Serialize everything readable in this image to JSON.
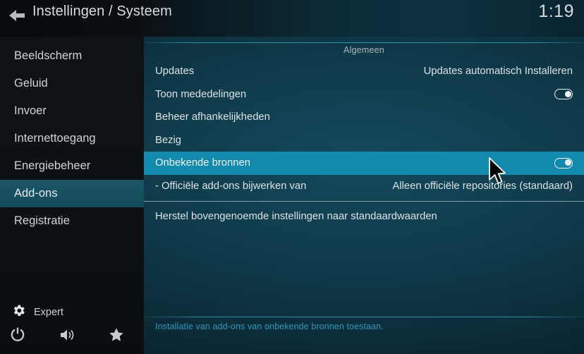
{
  "header": {
    "back_icon": "back-arrow-icon",
    "title": "Instellingen / Systeem",
    "clock": "1:19"
  },
  "sidebar": {
    "items": [
      {
        "label": "Beeldscherm",
        "selected": false
      },
      {
        "label": "Geluid",
        "selected": false
      },
      {
        "label": "Invoer",
        "selected": false
      },
      {
        "label": "Internettoegang",
        "selected": false
      },
      {
        "label": "Energiebeheer",
        "selected": false
      },
      {
        "label": "Add-ons",
        "selected": true
      },
      {
        "label": "Registratie",
        "selected": false
      }
    ],
    "footer": {
      "level_icon": "gear-icon",
      "level_label": "Expert",
      "buttons": [
        {
          "icon": "power-icon"
        },
        {
          "icon": "volume-icon"
        },
        {
          "icon": "star-icon"
        }
      ]
    }
  },
  "content": {
    "section_title": "Algemeen",
    "rows": [
      {
        "label": "Updates",
        "value": "Updates automatisch Installeren",
        "control": "value",
        "highlighted": false
      },
      {
        "label": "Toon mededelingen",
        "value": "",
        "control": "toggle",
        "toggle_on": true,
        "highlighted": false
      },
      {
        "label": "Beheer afhankelijkheden",
        "value": "",
        "control": "none",
        "highlighted": false
      },
      {
        "label": "Bezig",
        "value": "",
        "control": "none",
        "highlighted": false
      },
      {
        "label": "Onbekende bronnen",
        "value": "",
        "control": "toggle",
        "toggle_on": true,
        "highlighted": true
      },
      {
        "label": "- Officiële add-ons bijwerken van",
        "value": "Alleen officiële repositories (standaard)",
        "control": "value",
        "highlighted": false
      },
      {
        "label": "Herstel bovengenoemde instellingen naar standaardwaarden",
        "value": "",
        "control": "none",
        "highlighted": false,
        "divider_before": true
      }
    ],
    "help_text": "Installatie van add-ons van onbekende bronnen toestaan."
  },
  "colors": {
    "highlight": "#1389ad",
    "sidebar_selected": "#16505f",
    "help_text": "#2f97bb",
    "accent_line": "#2d90b0"
  }
}
